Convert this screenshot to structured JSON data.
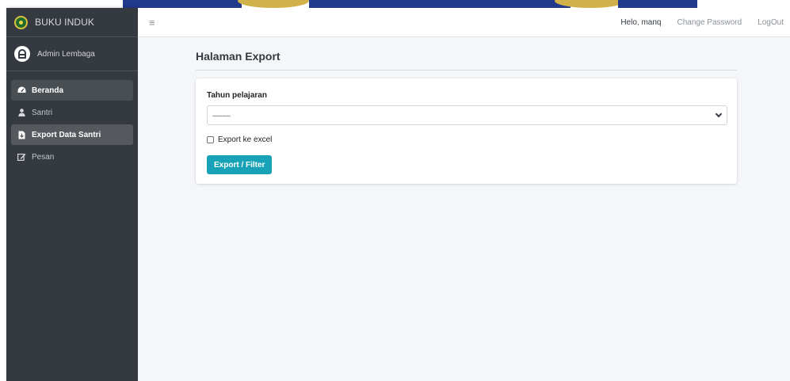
{
  "app": {
    "brand": "BUKU INDUK"
  },
  "topbar": {
    "greeting": "Helo, manq",
    "change_password": "Change Password",
    "logout": "LogOut",
    "menu_icon": "hamburger-icon"
  },
  "sidebar": {
    "user": "Admin Lembaga",
    "items": [
      {
        "label": "Beranda",
        "icon": "dashboard-icon",
        "state": "hover"
      },
      {
        "label": "Santri",
        "icon": "user-icon",
        "state": "normal"
      },
      {
        "label": "Export Data Santri",
        "icon": "file-export-icon",
        "state": "active"
      },
      {
        "label": "Pesan",
        "icon": "edit-icon",
        "state": "normal"
      }
    ]
  },
  "page": {
    "title": "Halaman Export"
  },
  "form": {
    "year_label": "Tahun pelajaran",
    "year_selected": "---------",
    "excel_checkbox_label": "Export ke excel",
    "excel_checked": false,
    "submit_label": "Export / Filter"
  },
  "colors": {
    "sidebar": "#343a40",
    "accent_button": "#17a2b8",
    "content_bg": "#f4f6f9"
  }
}
